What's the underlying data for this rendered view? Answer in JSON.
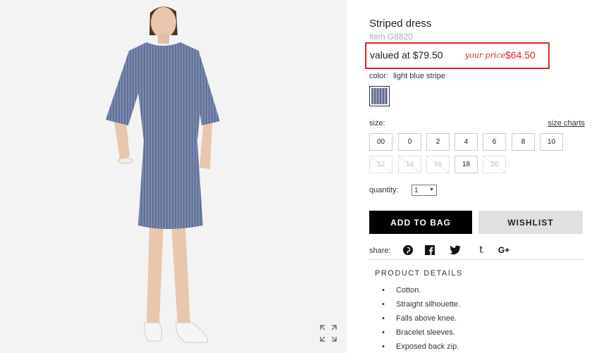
{
  "product": {
    "title": "Striped dress",
    "item_number": "item G8820"
  },
  "price": {
    "valued_label": "valued at $79.50",
    "your_price_label": "your price",
    "sale_price": "$64.50"
  },
  "color": {
    "label": "color:",
    "value": "light blue stripe"
  },
  "size": {
    "label": "size:",
    "charts_link": "size charts",
    "options": [
      {
        "label": "00",
        "available": true
      },
      {
        "label": "0",
        "available": true
      },
      {
        "label": "2",
        "available": true
      },
      {
        "label": "4",
        "available": true
      },
      {
        "label": "6",
        "available": true
      },
      {
        "label": "8",
        "available": true
      },
      {
        "label": "10",
        "available": true
      },
      {
        "label": "12",
        "available": false
      },
      {
        "label": "14",
        "available": false
      },
      {
        "label": "16",
        "available": false
      },
      {
        "label": "18",
        "available": true
      },
      {
        "label": "20",
        "available": false
      }
    ]
  },
  "quantity": {
    "label": "quantity:",
    "value": "1"
  },
  "actions": {
    "add_to_bag": "ADD TO BAG",
    "wishlist": "WISHLIST"
  },
  "share": {
    "label": "share:",
    "icons": [
      "pinterest-icon",
      "facebook-icon",
      "twitter-icon",
      "tumblr-icon",
      "google-plus-icon"
    ]
  },
  "product_details": {
    "heading": "PRODUCT DETAILS",
    "items": [
      "Cotton.",
      "Straight silhouette.",
      "Falls above knee.",
      "Bracelet sleeves.",
      "Exposed back zip."
    ]
  },
  "colors": {
    "accent_red": "#d9262b",
    "button_black": "#000000",
    "button_gray": "#e0e0e0",
    "dress_blue": "#7283a8"
  }
}
